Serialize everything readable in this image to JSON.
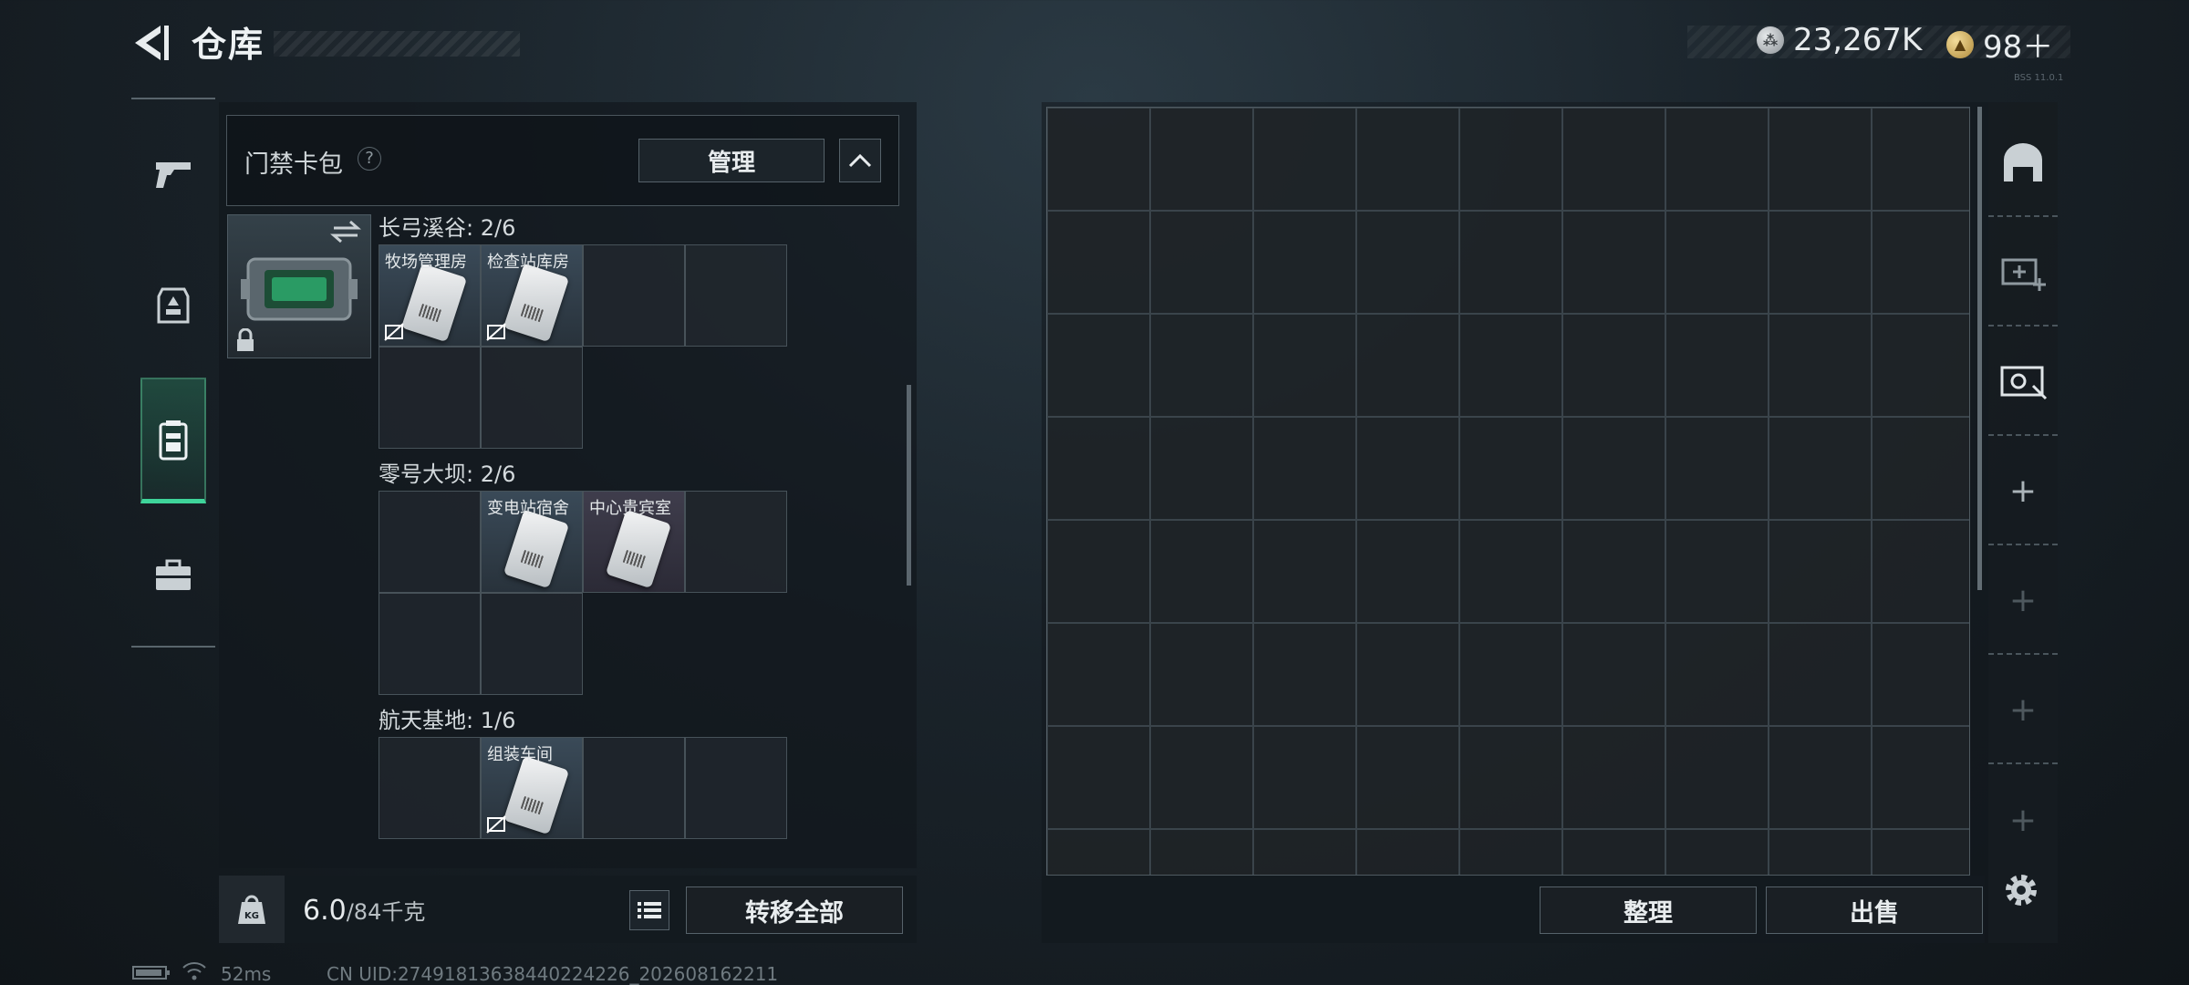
{
  "header": {
    "title": "仓库",
    "currency_silver": "23,267K",
    "currency_gold": "98＋",
    "version_tag": "BSS 11.0.1"
  },
  "rail": {
    "items": [
      {
        "name": "weapons",
        "icon": "pistol-icon"
      },
      {
        "name": "equipment",
        "icon": "armor-icon"
      },
      {
        "name": "keycards",
        "icon": "keycard-pack-icon",
        "active": true
      },
      {
        "name": "misc",
        "icon": "briefcase-icon"
      }
    ]
  },
  "cardpack": {
    "title": "门禁卡包",
    "help": "?",
    "manage_label": "管理"
  },
  "sections": [
    {
      "label": "长弓溪谷: 2/6",
      "cards": [
        "牧场管理房",
        "检查站库房",
        "",
        "",
        "",
        ""
      ]
    },
    {
      "label": "零号大坝: 2/6",
      "cards": [
        "",
        "变电站宿舍",
        "中心贵宾室",
        "",
        "",
        ""
      ]
    },
    {
      "label": "航天基地: 1/6",
      "cards": [
        "",
        "组装车间",
        "",
        "",
        "",
        ""
      ]
    }
  ],
  "footer": {
    "weight_current": "6.0",
    "weight_max": "/84千克",
    "weight_icon_label": "KG",
    "transfer_all_label": "转移全部"
  },
  "storage": {
    "sort_label": "整理",
    "sell_label": "出售"
  },
  "status": {
    "ping": "52ms",
    "uid": "CN UID:27491813638440224226_202608162211"
  }
}
